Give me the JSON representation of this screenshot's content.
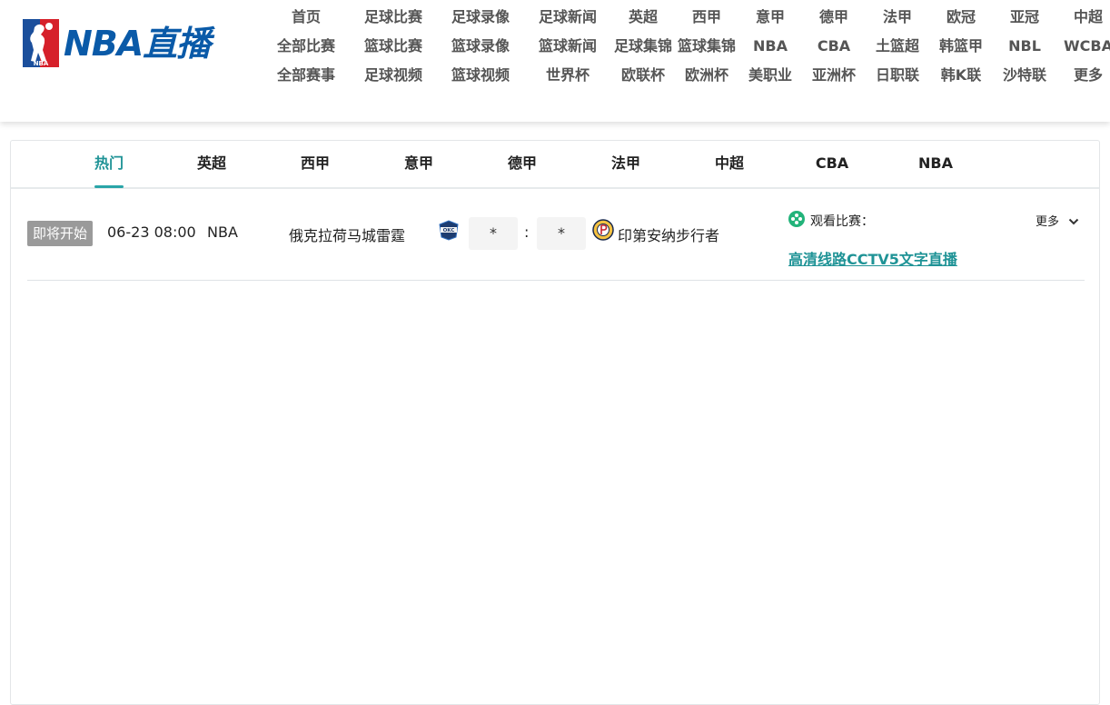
{
  "brand": {
    "name": "NBA直播",
    "emblem_text": "NBA"
  },
  "nav": {
    "rows": [
      [
        "首页",
        "足球比赛",
        "足球录像",
        "足球新闻",
        "英超",
        "西甲",
        "意甲",
        "德甲",
        "法甲",
        "欧冠",
        "亚冠",
        "中超"
      ],
      [
        "全部比赛",
        "篮球比赛",
        "篮球录像",
        "篮球新闻",
        "足球集锦",
        "篮球集锦",
        "NBA",
        "CBA",
        "土篮超",
        "韩篮甲",
        "NBL",
        "WCBA"
      ],
      [
        "全部赛事",
        "足球视频",
        "篮球视频",
        "世界杯",
        "欧联杯",
        "欧洲杯",
        "美职业",
        "亚洲杯",
        "日职联",
        "韩K联",
        "沙特联",
        "更多"
      ]
    ]
  },
  "tabs": {
    "items": [
      "热门",
      "英超",
      "西甲",
      "意甲",
      "德甲",
      "法甲",
      "中超",
      "CBA",
      "NBA"
    ],
    "active": "热门"
  },
  "match": {
    "status": "即将开始",
    "time": "06-23 08:00",
    "league": "NBA",
    "home_team": "俄克拉荷马城雷霆",
    "home_logo": "okc-thunder-logo",
    "away_team": "印第安纳步行者",
    "away_logo": "indiana-pacers-logo",
    "home_score": "*",
    "away_score": "*",
    "separator": ":",
    "watch_label": "观看比赛：",
    "more_label": "更多",
    "stream_link": "高清线路CCTV5文字直播"
  },
  "colors": {
    "accent": "#1f9396",
    "brand_blue": "#0a5aa8",
    "badge_gray": "#9a9a9a",
    "emblem_red": "#d6202a",
    "emblem_blue": "#1b4f9c"
  }
}
